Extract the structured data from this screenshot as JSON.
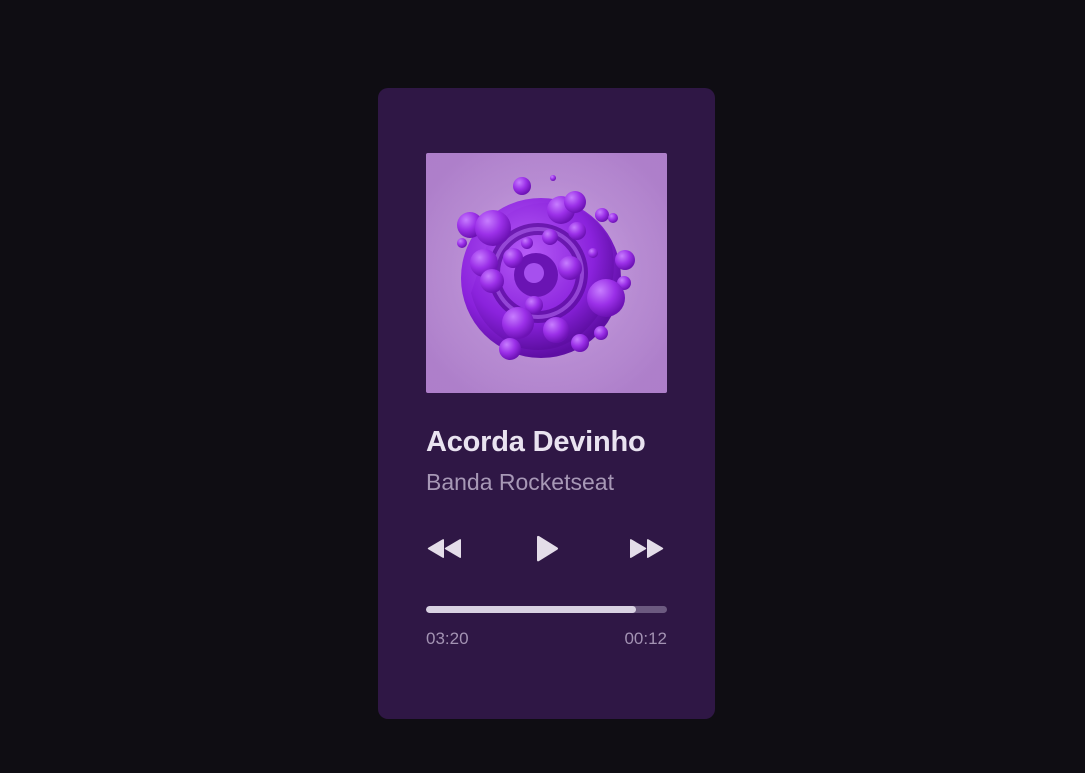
{
  "player": {
    "title": "Acorda Devinho",
    "artist": "Banda Rocketseat",
    "controls": {
      "previous_icon": "rewind-icon",
      "play_icon": "play-icon",
      "next_icon": "fast-forward-icon"
    },
    "progress": {
      "fraction": 0.87,
      "elapsed": "03:20",
      "remaining": "00:12"
    }
  },
  "colors": {
    "background": "#0f0d13",
    "card": "#2f1745",
    "album_background": "#c49ae0",
    "album_blob": "#8a2be2",
    "title": "#e9e3f0",
    "artist": "#a798b6",
    "progress_fill": "#d9d2e2",
    "progress_track": "#6c5a80"
  }
}
